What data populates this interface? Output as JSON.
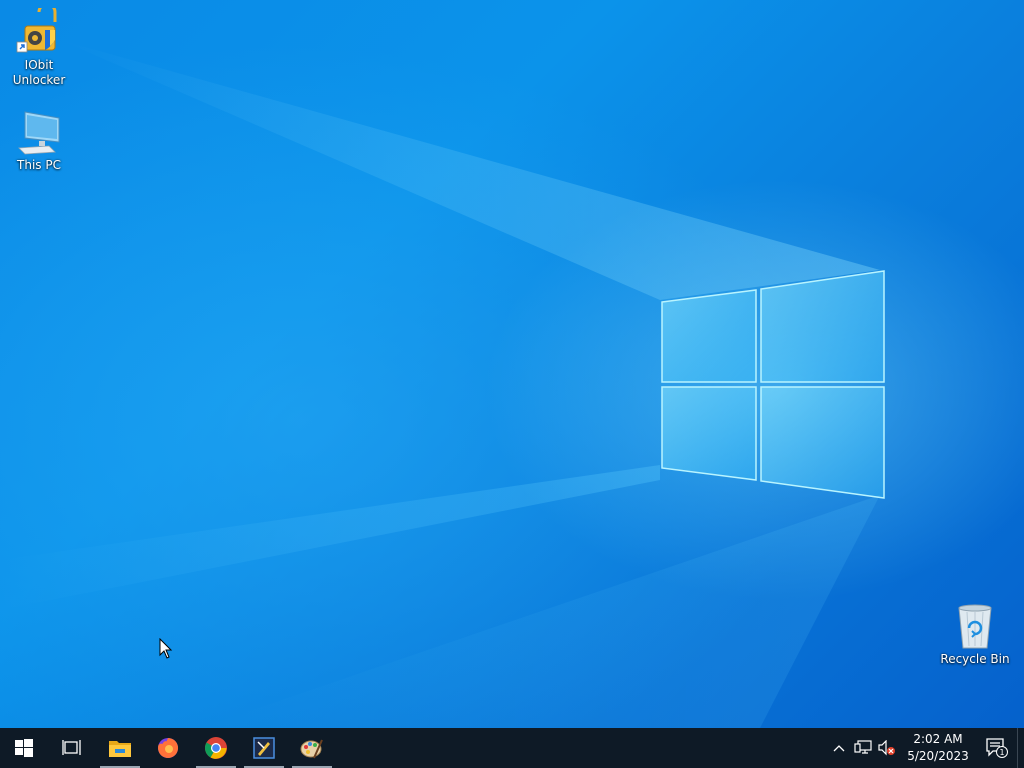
{
  "desktop": {
    "icons": [
      {
        "label": "IObit\nUnlocker",
        "line1": "IObit",
        "line2": "Unlocker",
        "icon": "iobit-unlocker-icon"
      },
      {
        "label": "This PC",
        "icon": "this-pc-icon"
      },
      {
        "label": "Recycle Bin",
        "icon": "recycle-bin-icon"
      }
    ]
  },
  "taskbar": {
    "start": {
      "icon": "windows-start-icon"
    },
    "task_view": {
      "icon": "task-view-icon"
    },
    "pinned": [
      {
        "name": "File Explorer",
        "icon": "file-explorer-icon",
        "running": true
      },
      {
        "name": "Firefox",
        "icon": "firefox-icon",
        "running": false
      },
      {
        "name": "Google Chrome",
        "icon": "chrome-icon",
        "running": true
      },
      {
        "name": "App",
        "icon": "app-icon",
        "running": true
      },
      {
        "name": "Paint",
        "icon": "paint-icon",
        "running": true
      }
    ],
    "tray": {
      "overflow_icon": "chevron-up-icon",
      "network_icon": "network-icon",
      "volume_icon": "volume-muted-icon",
      "time": "2:02 AM",
      "date": "5/20/2023",
      "notification_count": "1"
    }
  },
  "colors": {
    "taskbar_bg": "#0e1a26",
    "wallpaper_primary": "#0a8ae6",
    "wallpaper_dark": "#0561cc"
  }
}
